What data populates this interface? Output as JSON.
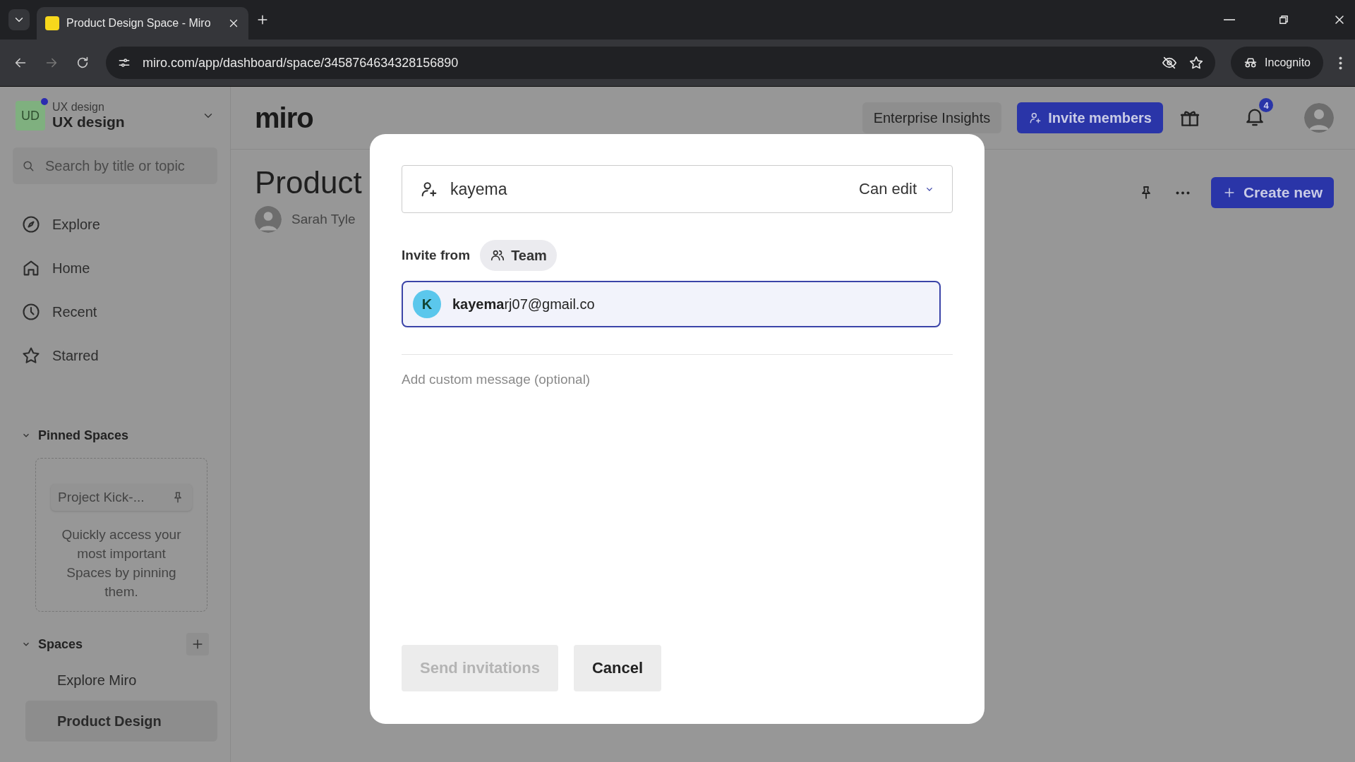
{
  "browser": {
    "tab_title": "Product Design Space - Miro",
    "url": "miro.com/app/dashboard/space/3458764634328156890",
    "profile": "Incognito"
  },
  "sidebar": {
    "workspace": {
      "badge": "UD",
      "caption": "UX design",
      "name": "UX design"
    },
    "search": {
      "placeholder": "Search by title or topic"
    },
    "nav": [
      {
        "kind": "explore",
        "label": "Explore"
      },
      {
        "kind": "home",
        "label": "Home"
      },
      {
        "kind": "recent",
        "label": "Recent"
      },
      {
        "kind": "starred",
        "label": "Starred"
      }
    ],
    "pinned": {
      "title": "Pinned Spaces",
      "expanded": true,
      "example": "Project Kick-...",
      "hint": "Quickly access your most important Spaces by pinning them."
    },
    "spaces": {
      "title": "Spaces",
      "expanded": true,
      "items": [
        {
          "label": "Explore Miro",
          "selected": false
        },
        {
          "label": "Product Design",
          "selected": true
        }
      ]
    }
  },
  "header": {
    "logo": "miro",
    "enterprise": "Enterprise Insights",
    "invite": "Invite members",
    "notifications": "4"
  },
  "page": {
    "title": "Product",
    "owner": "Sarah Tyle",
    "create": "Create new"
  },
  "dialog": {
    "query": "kayema",
    "role": "Can edit",
    "invite_from": "Invite from",
    "source": "Team",
    "suggestion": {
      "initial": "K",
      "email": "**kayema**rj07@gmail.co"
    },
    "message": {
      "placeholder": "Add custom message (optional)"
    },
    "buttons": [
      {
        "kind": "primary",
        "label": "Send invitations",
        "disabled": true
      },
      {
        "kind": "secondary",
        "label": "Cancel",
        "disabled": false
      }
    ]
  }
}
